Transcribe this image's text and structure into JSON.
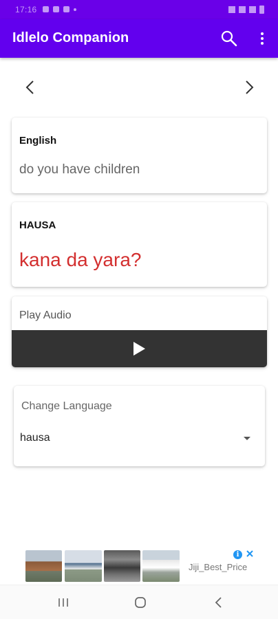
{
  "app_bar": {
    "title": "Idlelo Companion",
    "color": "#6200ee",
    "icons": [
      "search-icon",
      "more-vert-icon"
    ]
  },
  "navigation": {
    "prev_icon": "chevron-left-icon",
    "next_icon": "chevron-right-icon"
  },
  "source_card": {
    "language_label": "English",
    "text": "do you have children"
  },
  "translation_card": {
    "language_label": "HAUSA",
    "text": "kana da yara?",
    "text_color": "#d32f2f"
  },
  "audio_card": {
    "label": "Play Audio",
    "play_icon": "play-icon"
  },
  "language_selector": {
    "label": "Change Language",
    "selected_value": "hausa"
  },
  "ad": {
    "text": "Jiji_Best_Price",
    "icons": [
      "ad-info-icon",
      "ad-close-icon"
    ]
  },
  "system_nav": {
    "icons": [
      "recents-icon",
      "home-icon",
      "back-icon"
    ]
  }
}
